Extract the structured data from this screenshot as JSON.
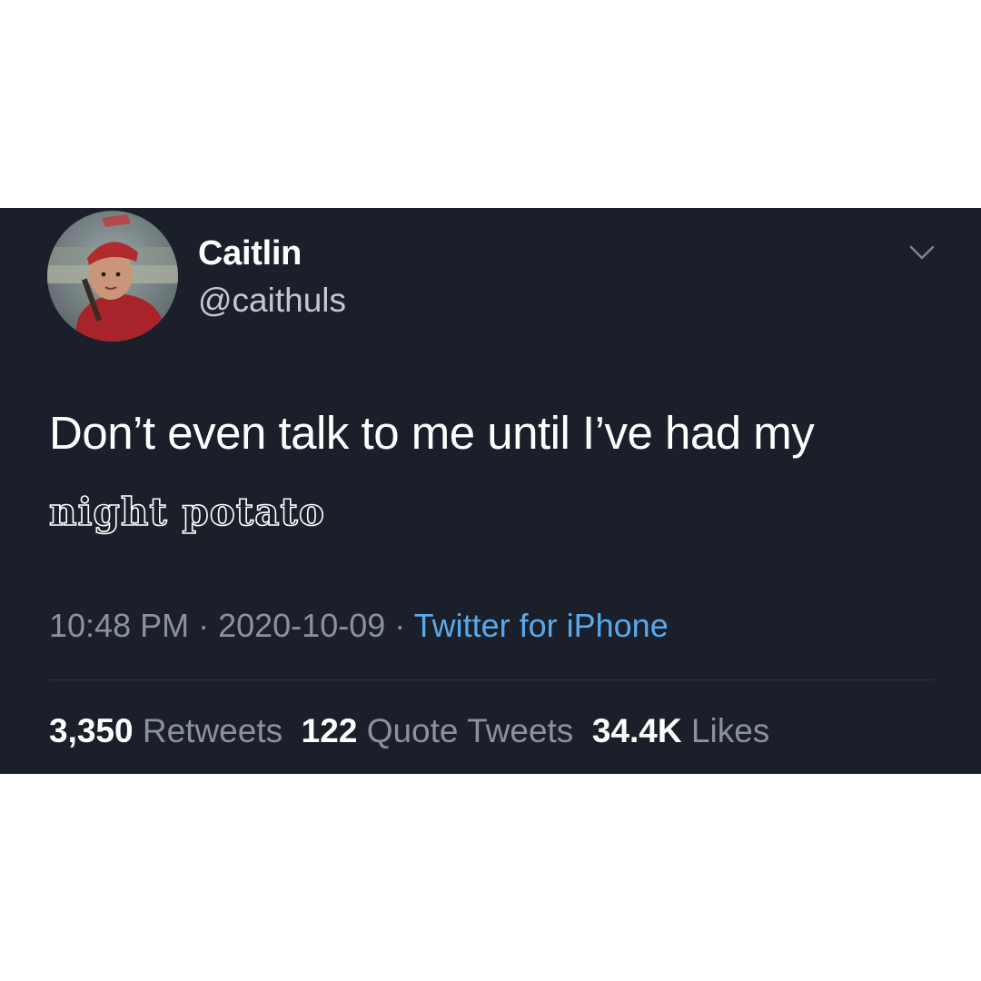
{
  "user": {
    "display_name": "Caitlin",
    "handle": "@caithuls",
    "avatar_icon": "profile-photo"
  },
  "tweet": {
    "text_line_1": "Don’t even talk to me until I’ve had my",
    "text_line_2": "night potato"
  },
  "meta": {
    "time": "10:48 PM",
    "separator": " · ",
    "date": "2020-10-09",
    "source": "Twitter for iPhone"
  },
  "stats": {
    "retweets_count": "3,350",
    "retweets_label": "Retweets",
    "quotes_count": "122",
    "quotes_label": "Quote Tweets",
    "likes_count": "34.4K",
    "likes_label": "Likes"
  },
  "colors": {
    "card_background": "#1b1f29",
    "link": "#5aa9ea",
    "secondary_text": "#8b929c",
    "page_background": "#ffffff"
  }
}
